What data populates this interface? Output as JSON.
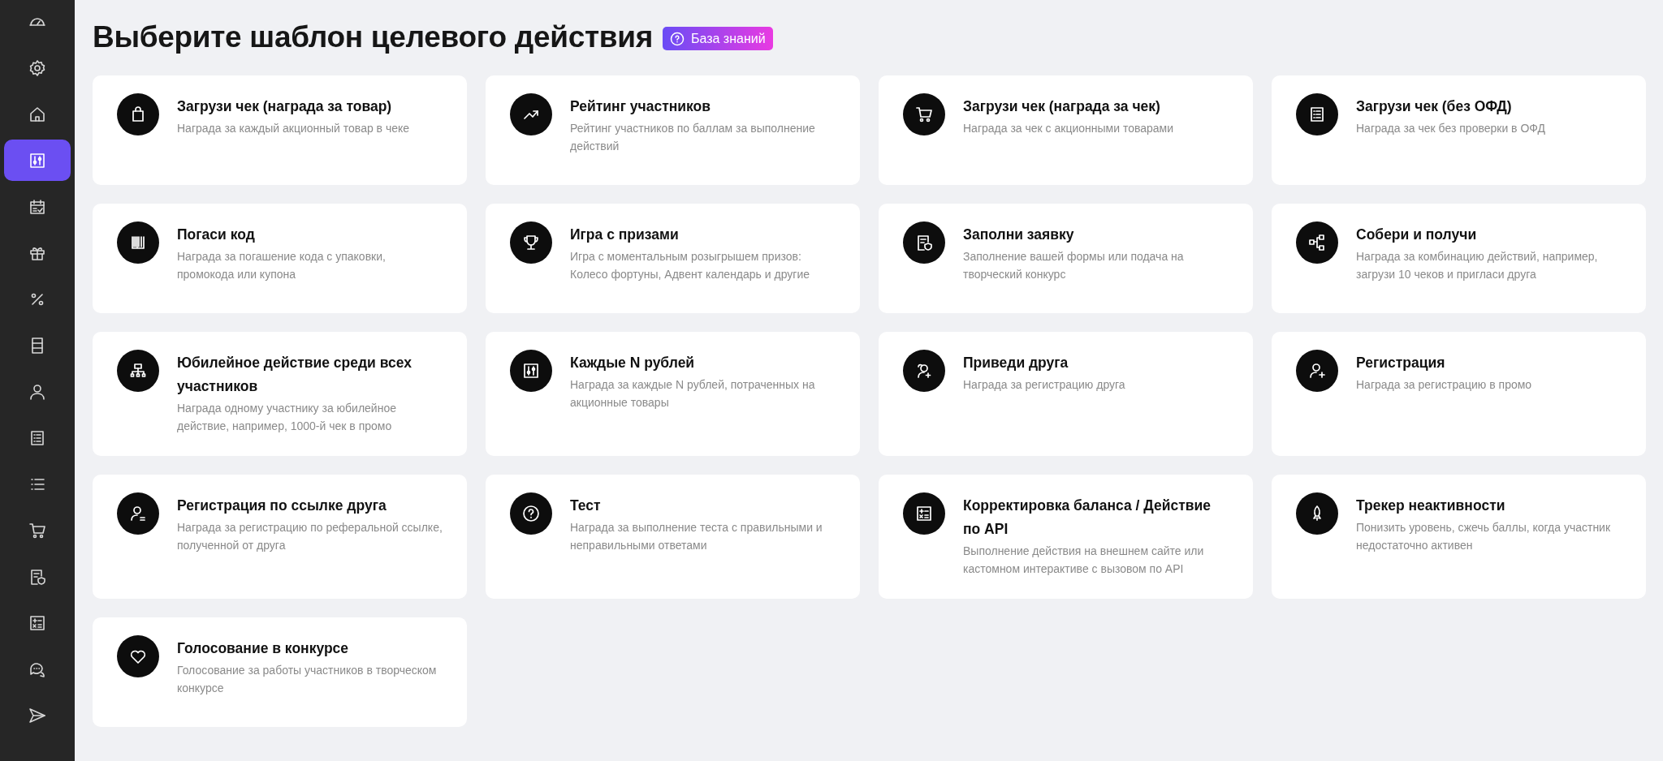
{
  "sidebar": {
    "items": [
      {
        "selected": false
      },
      {
        "selected": false
      },
      {
        "selected": false
      },
      {
        "selected": true
      },
      {
        "selected": false
      },
      {
        "selected": false
      },
      {
        "selected": false
      },
      {
        "selected": false
      },
      {
        "selected": false
      },
      {
        "selected": false
      },
      {
        "selected": false
      },
      {
        "selected": false
      },
      {
        "selected": false
      },
      {
        "selected": false
      },
      {
        "selected": false
      },
      {
        "selected": false
      }
    ]
  },
  "header": {
    "title": "Выберите шаблон целевого действия",
    "help_button": "База знаний"
  },
  "templates": [
    {
      "title": "Загрузи чек (награда за товар)",
      "description": "Награда за каждый акционный товар в чеке"
    },
    {
      "title": "Рейтинг участников",
      "description": "Рейтинг участников по баллам за выполнение действий"
    },
    {
      "title": "Загрузи чек (награда за чек)",
      "description": "Награда за чек с акционными товарами"
    },
    {
      "title": "Загрузи чек (без ОФД)",
      "description": "Награда за чек без проверки в ОФД"
    },
    {
      "title": "Погаси код",
      "description": "Награда за погашение кода с упаковки, промокода или купона"
    },
    {
      "title": "Игра с призами",
      "description": "Игра с моментальным розыгрышем призов: Колесо фортуны, Адвент календарь и другие"
    },
    {
      "title": "Заполни заявку",
      "description": "Заполнение вашей формы или подача на творческий конкурс"
    },
    {
      "title": "Собери и получи",
      "description": "Награда за комбинацию действий, например, загрузи 10 чеков и пригласи друга"
    },
    {
      "title": "Юбилейное действие среди всех участников",
      "description": "Награда одному участнику за юбилейное действие, например, 1000-й чек в промо"
    },
    {
      "title": "Каждые N рублей",
      "description": "Награда за каждые N рублей, потраченных на акционные товары"
    },
    {
      "title": "Приведи друга",
      "description": "Награда за регистрацию друга"
    },
    {
      "title": "Регистрация",
      "description": "Награда за регистрацию в промо"
    },
    {
      "title": "Регистрация по ссылке друга",
      "description": "Награда за регистрацию по реферальной ссылке, полученной от друга"
    },
    {
      "title": "Тест",
      "description": "Награда за выполнение теста с правильными и неправильными ответами"
    },
    {
      "title": "Корректировка баланса / Действие по API",
      "description": "Выполнение действия на внешнем сайте или кастомном интерактиве с вызовом по API"
    },
    {
      "title": "Трекер неактивности",
      "description": "Понизить уровень, сжечь баллы, когда участник недостаточно активен"
    },
    {
      "title": "Голосование в конкурсе",
      "description": "Голосование за работы участников в творческом конкурсе"
    }
  ]
}
